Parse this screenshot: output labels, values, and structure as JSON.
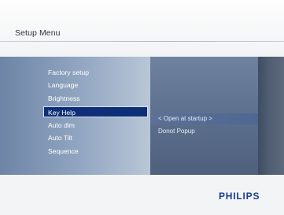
{
  "header": {
    "title": "Setup Menu"
  },
  "menu": {
    "items": [
      {
        "label": "Factory setup"
      },
      {
        "label": "Language"
      },
      {
        "label": "Brightness"
      },
      {
        "label": "Key Help"
      },
      {
        "label": "Auto dim"
      },
      {
        "label": "Auto Tilt"
      },
      {
        "label": "Sequence"
      }
    ],
    "selected_label": "Key Help"
  },
  "submenu": {
    "options": [
      {
        "label": "< Open at startup >"
      },
      {
        "label": "Donot Popup"
      }
    ],
    "selected_label": "< Open at startup >"
  },
  "footer": {
    "logo_text": "PHILIPS"
  },
  "colors": {
    "selection_bg": "#0e2f78",
    "logo": "#1a3d8f",
    "panel_dark": "#50627f"
  }
}
